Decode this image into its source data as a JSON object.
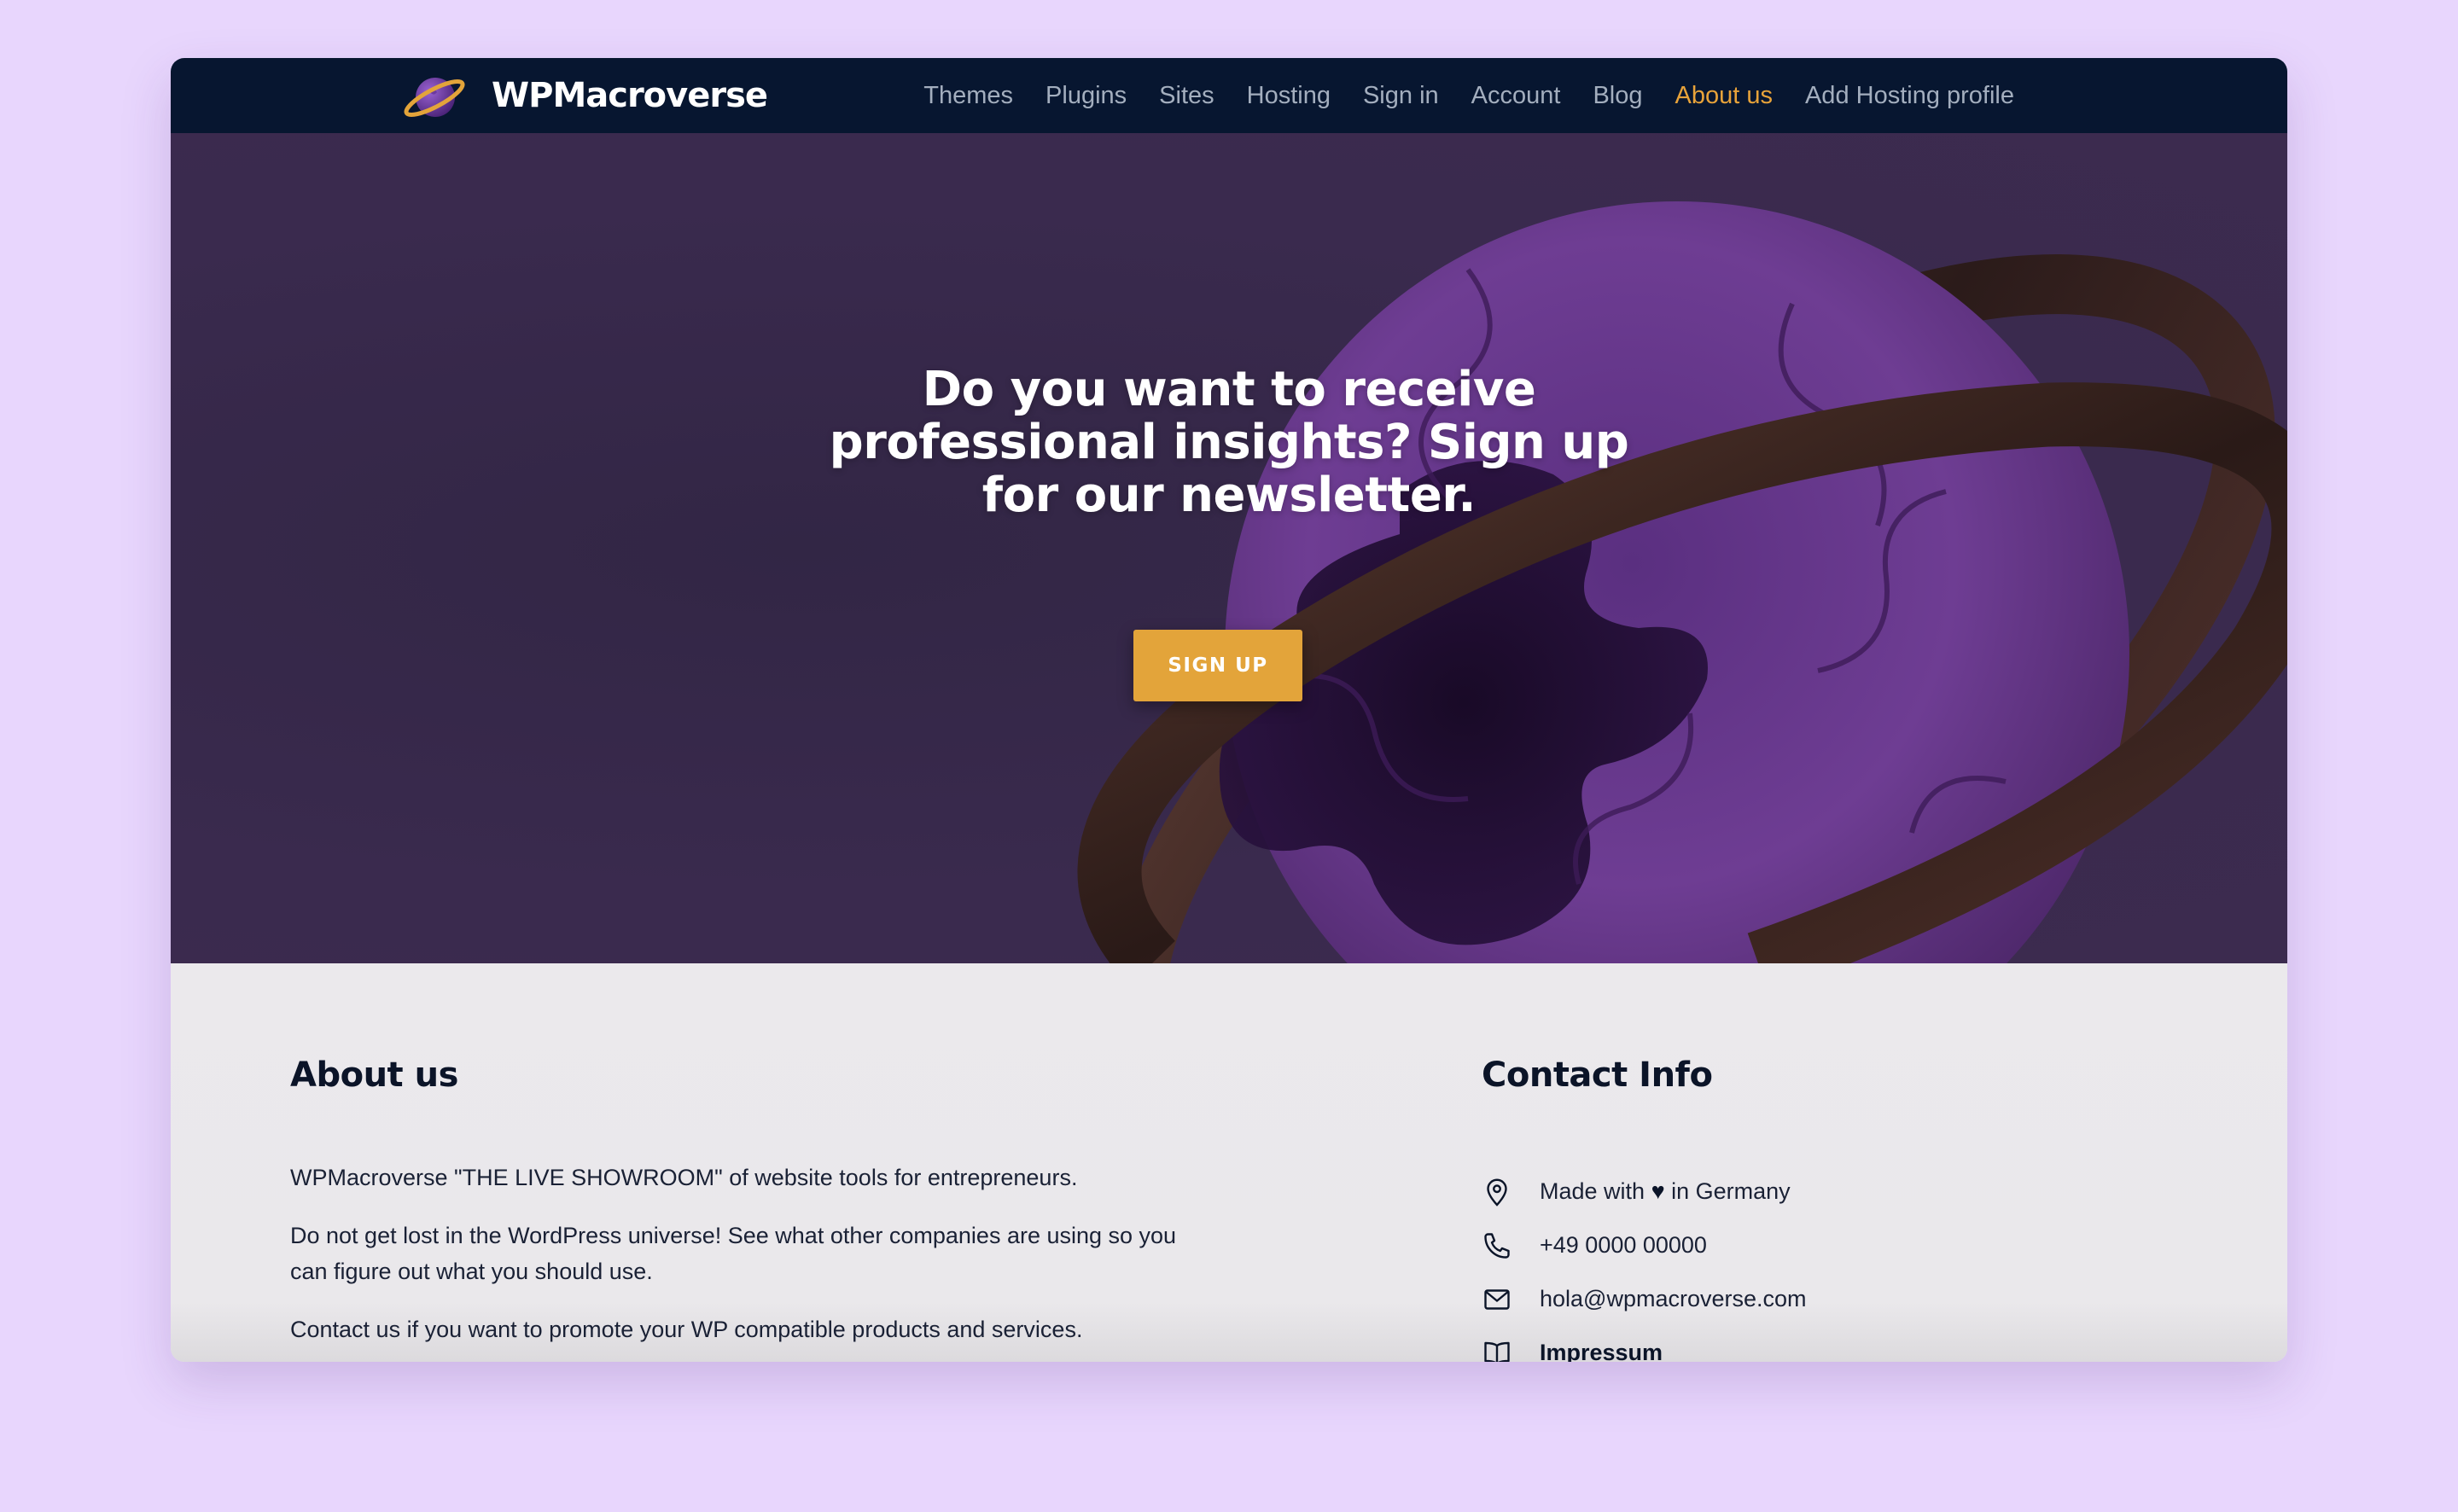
{
  "brand": {
    "name": "WPMacroverse"
  },
  "nav": {
    "items": [
      {
        "label": "Themes"
      },
      {
        "label": "Plugins"
      },
      {
        "label": "Sites"
      },
      {
        "label": "Hosting"
      },
      {
        "label": "Sign in"
      },
      {
        "label": "Account"
      },
      {
        "label": "Blog"
      },
      {
        "label": "About us",
        "active": true
      },
      {
        "label": "Add Hosting profile"
      }
    ]
  },
  "hero": {
    "title": "Do you want to receive professional insights? Sign up for our newsletter.",
    "button_label": "SIGN UP"
  },
  "about": {
    "title": "About us",
    "paragraphs": [
      "WPMacroverse \"THE LIVE SHOWROOM\" of website tools for entrepreneurs.",
      "Do not get lost in the WordPress universe! See what other companies are using so you can figure out what you should use.",
      "Contact us if you want to promote your WP compatible products and services."
    ]
  },
  "contact": {
    "title": "Contact Info",
    "made_prefix": "Made with",
    "made_heart": "♥",
    "made_suffix": "in Germany",
    "phone": "+49 0000 00000",
    "email": "hola@wpmacroverse.com",
    "impressum": "Impressum",
    "icons": [
      "location-pin-icon",
      "phone-icon",
      "mail-icon",
      "book-icon"
    ]
  },
  "colors": {
    "page_bg": "#e8d6fd",
    "nav_bg": "#071630",
    "accent": "#e3a43a",
    "hero_bg": "#3a2a4e",
    "footer_bg": "#ebe9ec"
  }
}
